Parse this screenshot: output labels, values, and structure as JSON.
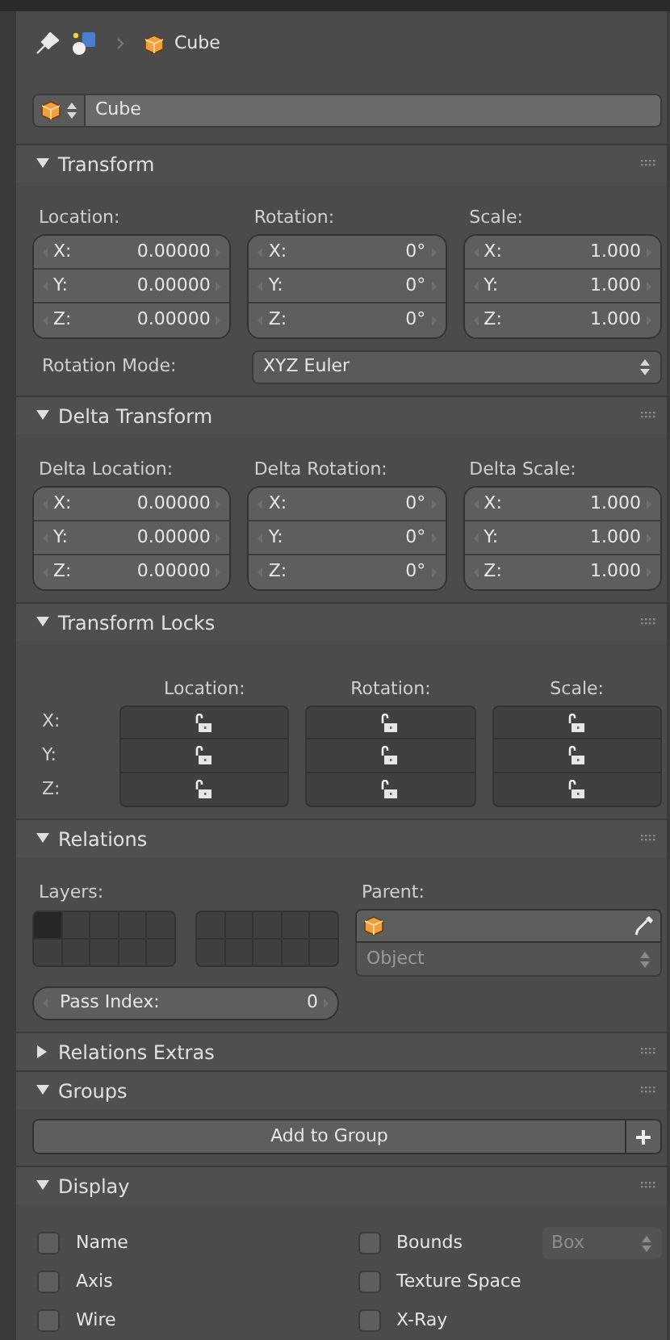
{
  "breadcrumb": {
    "label": "Cube"
  },
  "object_name": {
    "value": "Cube"
  },
  "panels": [
    {
      "kind": "vectors",
      "title": "Transform",
      "expanded": true,
      "columns": [
        {
          "label": "Location:",
          "fields": [
            {
              "axis": "X:",
              "value": "0.00000"
            },
            {
              "axis": "Y:",
              "value": "0.00000"
            },
            {
              "axis": "Z:",
              "value": "0.00000"
            }
          ]
        },
        {
          "label": "Rotation:",
          "fields": [
            {
              "axis": "X:",
              "value": "0°"
            },
            {
              "axis": "Y:",
              "value": "0°"
            },
            {
              "axis": "Z:",
              "value": "0°"
            }
          ]
        },
        {
          "label": "Scale:",
          "fields": [
            {
              "axis": "X:",
              "value": "1.000"
            },
            {
              "axis": "Y:",
              "value": "1.000"
            },
            {
              "axis": "Z:",
              "value": "1.000"
            }
          ]
        }
      ],
      "rotation_mode": {
        "label": "Rotation Mode:",
        "value": "XYZ Euler"
      }
    },
    {
      "kind": "vectors",
      "title": "Delta Transform",
      "expanded": true,
      "columns": [
        {
          "label": "Delta Location:",
          "fields": [
            {
              "axis": "X:",
              "value": "0.00000"
            },
            {
              "axis": "Y:",
              "value": "0.00000"
            },
            {
              "axis": "Z:",
              "value": "0.00000"
            }
          ]
        },
        {
          "label": "Delta Rotation:",
          "fields": [
            {
              "axis": "X:",
              "value": "0°"
            },
            {
              "axis": "Y:",
              "value": "0°"
            },
            {
              "axis": "Z:",
              "value": "0°"
            }
          ]
        },
        {
          "label": "Delta Scale:",
          "fields": [
            {
              "axis": "X:",
              "value": "1.000"
            },
            {
              "axis": "Y:",
              "value": "1.000"
            },
            {
              "axis": "Z:",
              "value": "1.000"
            }
          ]
        }
      ]
    },
    {
      "kind": "locks",
      "title": "Transform Locks",
      "expanded": true,
      "columns": [
        "Location:",
        "Rotation:",
        "Scale:"
      ],
      "rows": [
        {
          "axis": "X:",
          "locks": [
            {
              "locked": false
            },
            {
              "locked": false
            },
            {
              "locked": false
            }
          ]
        },
        {
          "axis": "Y:",
          "locks": [
            {
              "locked": false
            },
            {
              "locked": false
            },
            {
              "locked": false
            }
          ]
        },
        {
          "axis": "Z:",
          "locks": [
            {
              "locked": false
            },
            {
              "locked": false
            },
            {
              "locked": false
            }
          ]
        }
      ]
    },
    {
      "kind": "relations",
      "title": "Relations",
      "expanded": true,
      "layers_label": "Layers:",
      "layer_blocks": [
        {
          "cells": [
            {
              "selected": true
            },
            {
              "selected": false
            },
            {
              "selected": false
            },
            {
              "selected": false
            },
            {
              "selected": false
            },
            {
              "selected": false
            },
            {
              "selected": false
            },
            {
              "selected": false
            },
            {
              "selected": false
            },
            {
              "selected": false
            }
          ]
        },
        {
          "cells": [
            {
              "selected": false
            },
            {
              "selected": false
            },
            {
              "selected": false
            },
            {
              "selected": false
            },
            {
              "selected": false
            },
            {
              "selected": false
            },
            {
              "selected": false
            },
            {
              "selected": false
            },
            {
              "selected": false
            },
            {
              "selected": false
            }
          ]
        }
      ],
      "parent_label": "Parent:",
      "parent_type": {
        "value": "Object",
        "disabled": true
      },
      "pass_index": {
        "label": "Pass Index:",
        "value": "0"
      }
    },
    {
      "title": "Relations Extras",
      "expanded": false
    },
    {
      "kind": "groups",
      "title": "Groups",
      "expanded": true,
      "button": "Add to Group"
    },
    {
      "kind": "display",
      "title": "Display",
      "expanded": true,
      "checkboxes": [
        {
          "label": "Name",
          "checked": false
        },
        {
          "label": "Bounds",
          "checked": false
        },
        {
          "label": "Axis",
          "checked": false
        },
        {
          "label": "Texture Space",
          "checked": false
        },
        {
          "label": "Wire",
          "checked": false
        },
        {
          "label": "X-Ray",
          "checked": false
        }
      ],
      "bounds_type": {
        "value": "Box",
        "disabled": true
      }
    }
  ]
}
